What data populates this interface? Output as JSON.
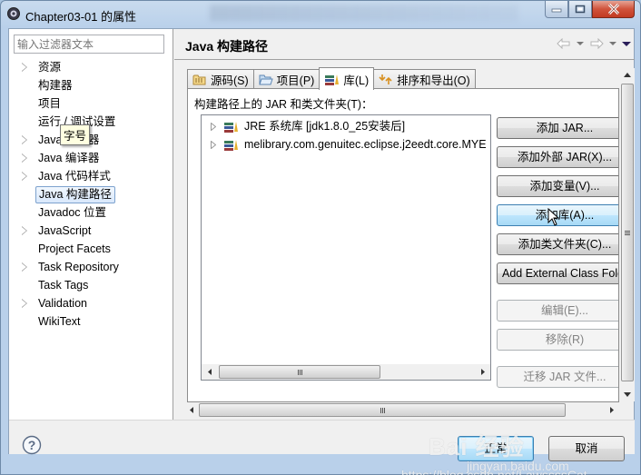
{
  "window": {
    "title": "Chapter03-01 的属性",
    "controls": [
      "minimize",
      "maximize",
      "close"
    ]
  },
  "sidebar": {
    "filter_placeholder": "输入过滤器文本",
    "items": [
      {
        "label": "资源",
        "expandable": true,
        "selected": false
      },
      {
        "label": "构建器",
        "expandable": false,
        "selected": false
      },
      {
        "label": "项目",
        "expandable": false,
        "selected": false
      },
      {
        "label": "运行 / 调试设置",
        "expandable": false,
        "selected": false
      },
      {
        "label": "Java 编辑器",
        "expandable": true,
        "selected": false
      },
      {
        "label": "Java 编译器",
        "expandable": true,
        "selected": false
      },
      {
        "label": "Java 代码样式",
        "expandable": true,
        "selected": false
      },
      {
        "label": "Java 构建路径",
        "expandable": false,
        "selected": true
      },
      {
        "label": "Javadoc 位置",
        "expandable": false,
        "selected": false
      },
      {
        "label": "JavaScript",
        "expandable": true,
        "selected": false
      },
      {
        "label": "Project Facets",
        "expandable": false,
        "selected": false
      },
      {
        "label": "Task Repository",
        "expandable": true,
        "selected": false
      },
      {
        "label": "Task Tags",
        "expandable": false,
        "selected": false
      },
      {
        "label": "Validation",
        "expandable": true,
        "selected": false
      },
      {
        "label": "WikiText",
        "expandable": false,
        "selected": false
      }
    ],
    "tooltip": "字号"
  },
  "main": {
    "title": "Java 构建路径",
    "nav": {
      "back_icon": "back-arrow-icon",
      "forward_icon": "forward-arrow-icon",
      "menu_icon": "view-menu-icon"
    },
    "tabs": [
      {
        "label": "源码(S)",
        "icon": "source-folder-icon",
        "active": false
      },
      {
        "label": "项目(P)",
        "icon": "project-folder-icon",
        "active": false
      },
      {
        "label": "库(L)",
        "icon": "library-icon",
        "active": true
      },
      {
        "label": "排序和导出(O)",
        "icon": "order-export-icon",
        "active": false
      }
    ],
    "section_label": "构建路径上的 JAR 和类文件夹(T)：",
    "libraries": [
      {
        "label": "JRE 系统库 [jdk1.8.0_25安装后]",
        "icon": "library-icon"
      },
      {
        "label": "melibrary.com.genuitec.eclipse.j2eedt.core.MYE",
        "icon": "library-icon"
      }
    ],
    "buttons": [
      {
        "label": "添加 JAR...",
        "state": "normal"
      },
      {
        "label": "添加外部 JAR(X)...",
        "state": "normal"
      },
      {
        "label": "添加变量(V)...",
        "state": "normal"
      },
      {
        "label": "添加库(A)...",
        "state": "hover"
      },
      {
        "label": "添加类文件夹(C)...",
        "state": "normal"
      },
      {
        "label": "Add External Class Folder...",
        "state": "normal"
      },
      {
        "label": "编辑(E)...",
        "state": "disabled"
      },
      {
        "label": "移除(R)",
        "state": "disabled"
      },
      {
        "label": "迁移 JAR 文件...",
        "state": "disabled"
      }
    ]
  },
  "footer": {
    "help_icon": "help-icon",
    "ok_label": "正常",
    "cancel_label": "取消"
  },
  "watermark": {
    "brand": "Bai 经验",
    "sub": "jingyan.baidu.com",
    "url": "https://blog.csdn.net/LawssssCat"
  }
}
